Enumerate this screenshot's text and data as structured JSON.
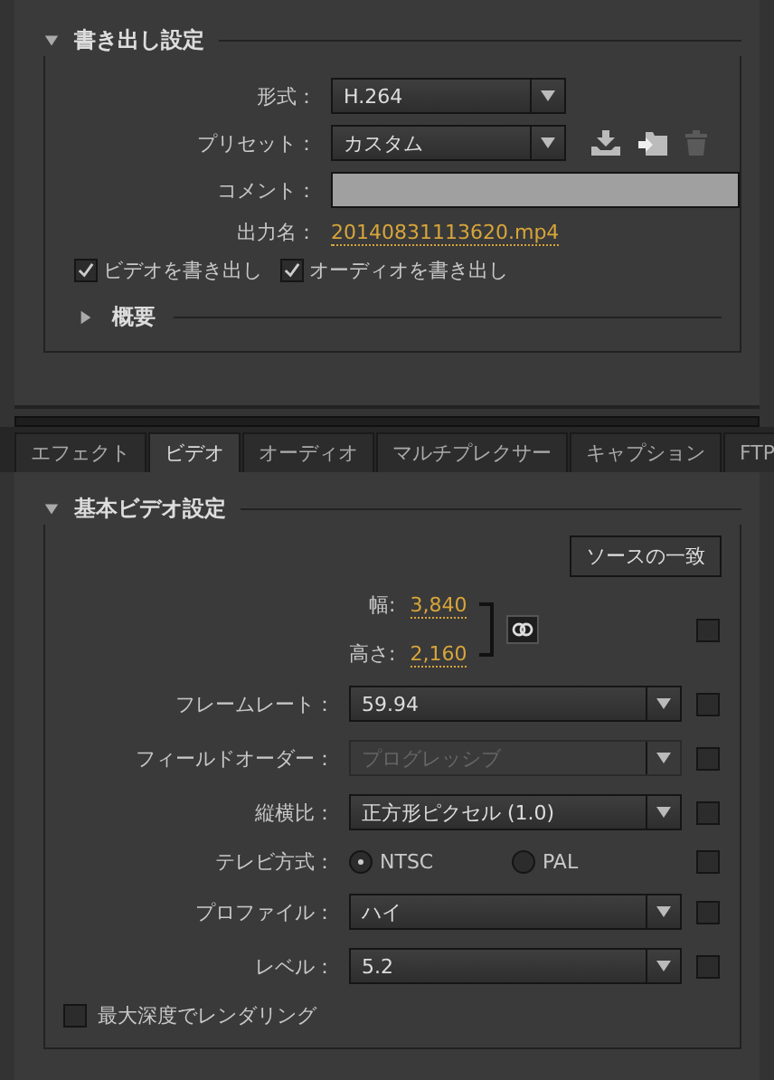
{
  "export_settings": {
    "title": "書き出し設定",
    "expanded": true,
    "format": {
      "label": "形式：",
      "value": "H.264"
    },
    "preset": {
      "label": "プリセット：",
      "value": "カスタム"
    },
    "comment": {
      "label": "コメント："
    },
    "output_name": {
      "label": "出力名：",
      "value": "20140831113620.mp4"
    },
    "checkboxes": [
      {
        "label": "ビデオを書き出し",
        "checked": true
      },
      {
        "label": "オーディオを書き出し",
        "checked": true
      }
    ],
    "summary": {
      "title": "概要",
      "expanded": false
    }
  },
  "tabs": [
    {
      "label": "エフェクト",
      "selected": false
    },
    {
      "label": "ビデオ",
      "selected": true
    },
    {
      "label": "オーディオ",
      "selected": false
    },
    {
      "label": "マルチプレクサー",
      "selected": false
    },
    {
      "label": "キャプション",
      "selected": false
    },
    {
      "label": "FTP",
      "selected": false
    }
  ],
  "video_settings": {
    "title": "基本ビデオ設定",
    "expanded": true,
    "match_source_button": "ソースの一致",
    "width": {
      "label": "幅:",
      "value": "3,840"
    },
    "height": {
      "label": "高さ:",
      "value": "2,160"
    },
    "dimensions_checked": false,
    "rows": [
      {
        "kind": "dropdown",
        "label": "フレームレート：",
        "value": "59.94",
        "disabled": false,
        "checked": false
      },
      {
        "kind": "dropdown",
        "label": "フィールドオーダー：",
        "value": "プログレッシブ",
        "disabled": true,
        "checked": false
      },
      {
        "kind": "dropdown",
        "label": "縦横比：",
        "value": "正方形ピクセル (1.0)",
        "disabled": false,
        "checked": false
      },
      {
        "kind": "radio",
        "label": "テレビ方式：",
        "options": [
          {
            "label": "NTSC",
            "selected": true
          },
          {
            "label": "PAL",
            "selected": false
          }
        ],
        "checked": false
      },
      {
        "kind": "dropdown",
        "label": "プロファイル：",
        "value": "ハイ",
        "disabled": false,
        "checked": false
      },
      {
        "kind": "dropdown",
        "label": "レベル：",
        "value": "5.2",
        "disabled": false,
        "checked": false
      }
    ],
    "max_depth": {
      "label": "最大深度でレンダリング",
      "checked": false
    }
  }
}
